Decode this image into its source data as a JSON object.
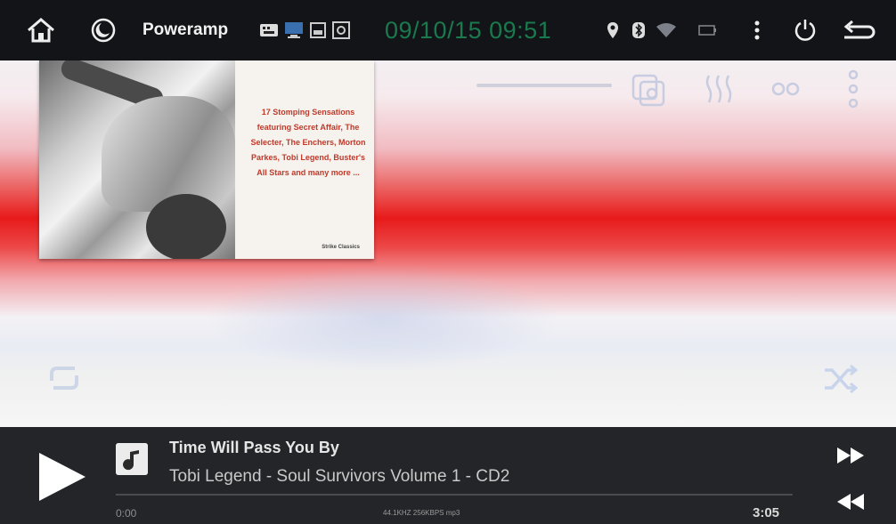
{
  "status_bar": {
    "app_name": "Poweramp",
    "datetime": "09/10/15 09:51"
  },
  "album_art": {
    "text": "17 Stomping Sensations featuring Secret Affair, The Selecter, The Enchers, Morton Parkes, Tobi Legend, Buster's All Stars and many more ...",
    "credit": "Strike Classics"
  },
  "now_playing": {
    "title": "Time Will Pass You By",
    "subtitle": "Tobi Legend - Soul Survivors Volume 1 - CD2",
    "position": "0:00",
    "duration": "3:05",
    "format_info": "44.1KHZ 256KBPS mp3",
    "progress": 0
  },
  "colors": {
    "accent_red": "#e81a1a",
    "time_green": "#1a7a4e",
    "bar_bg": "#242528"
  }
}
